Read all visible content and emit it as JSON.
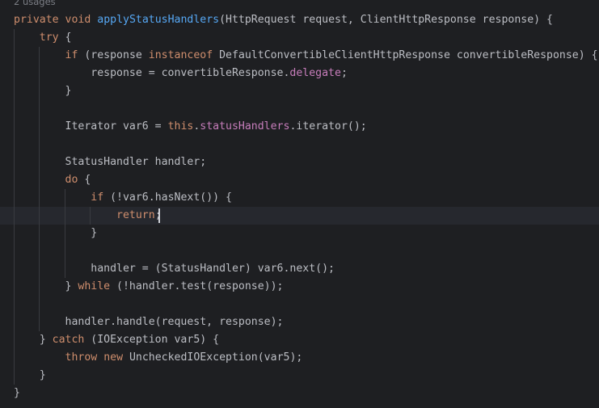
{
  "editor": {
    "usages_hint": "2 usages",
    "lines": [
      [
        {
          "t": "private",
          "c": "kw"
        },
        {
          "t": " "
        },
        {
          "t": "void",
          "c": "kw"
        },
        {
          "t": " "
        },
        {
          "t": "applyStatusHandlers",
          "c": "fn"
        },
        {
          "t": "(HttpRequest request, ClientHttpResponse response) {"
        }
      ],
      [
        {
          "t": "    "
        },
        {
          "t": "try",
          "c": "kw"
        },
        {
          "t": " {"
        }
      ],
      [
        {
          "t": "        "
        },
        {
          "t": "if",
          "c": "kw"
        },
        {
          "t": " (response "
        },
        {
          "t": "instanceof",
          "c": "kw"
        },
        {
          "t": " DefaultConvertibleClientHttpResponse convertibleResponse) {"
        }
      ],
      [
        {
          "t": "            response = convertibleResponse."
        },
        {
          "t": "delegate",
          "c": "fld"
        },
        {
          "t": ";"
        }
      ],
      [
        {
          "t": "        }"
        }
      ],
      [],
      [
        {
          "t": "        Iterator var6 = "
        },
        {
          "t": "this",
          "c": "kw"
        },
        {
          "t": "."
        },
        {
          "t": "statusHandlers",
          "c": "fld"
        },
        {
          "t": ".iterator();"
        }
      ],
      [],
      [
        {
          "t": "        StatusHandler handler;"
        }
      ],
      [
        {
          "t": "        "
        },
        {
          "t": "do",
          "c": "kw"
        },
        {
          "t": " {"
        }
      ],
      [
        {
          "t": "            "
        },
        {
          "t": "if",
          "c": "kw"
        },
        {
          "t": " (!var6.hasNext()) {"
        }
      ],
      [
        {
          "t": "                "
        },
        {
          "t": "return",
          "c": "kw"
        },
        {
          "t": ";"
        }
      ],
      [
        {
          "t": "            }"
        }
      ],
      [],
      [
        {
          "t": "            handler = (StatusHandler) var6.next();"
        }
      ],
      [
        {
          "t": "        } "
        },
        {
          "t": "while",
          "c": "kw"
        },
        {
          "t": " (!handler.test(response));"
        }
      ],
      [],
      [
        {
          "t": "        handler.handle(request, response);"
        }
      ],
      [
        {
          "t": "    } "
        },
        {
          "t": "catch",
          "c": "kw"
        },
        {
          "t": " (IOException var5) {"
        }
      ],
      [
        {
          "t": "        "
        },
        {
          "t": "throw",
          "c": "kw"
        },
        {
          "t": " "
        },
        {
          "t": "new",
          "c": "kw"
        },
        {
          "t": " UncheckedIOException(var5);"
        }
      ],
      [
        {
          "t": "    }"
        }
      ],
      [
        {
          "t": "}"
        }
      ]
    ],
    "colors": {
      "background": "#1e1f22",
      "current_line": "#26282e",
      "keyword": "#cf8e6d",
      "function_decl": "#56a8f5",
      "field": "#c77dbb",
      "text": "#bcbec4",
      "hint": "#7b7e85",
      "indent_guide": "#393b40"
    }
  }
}
